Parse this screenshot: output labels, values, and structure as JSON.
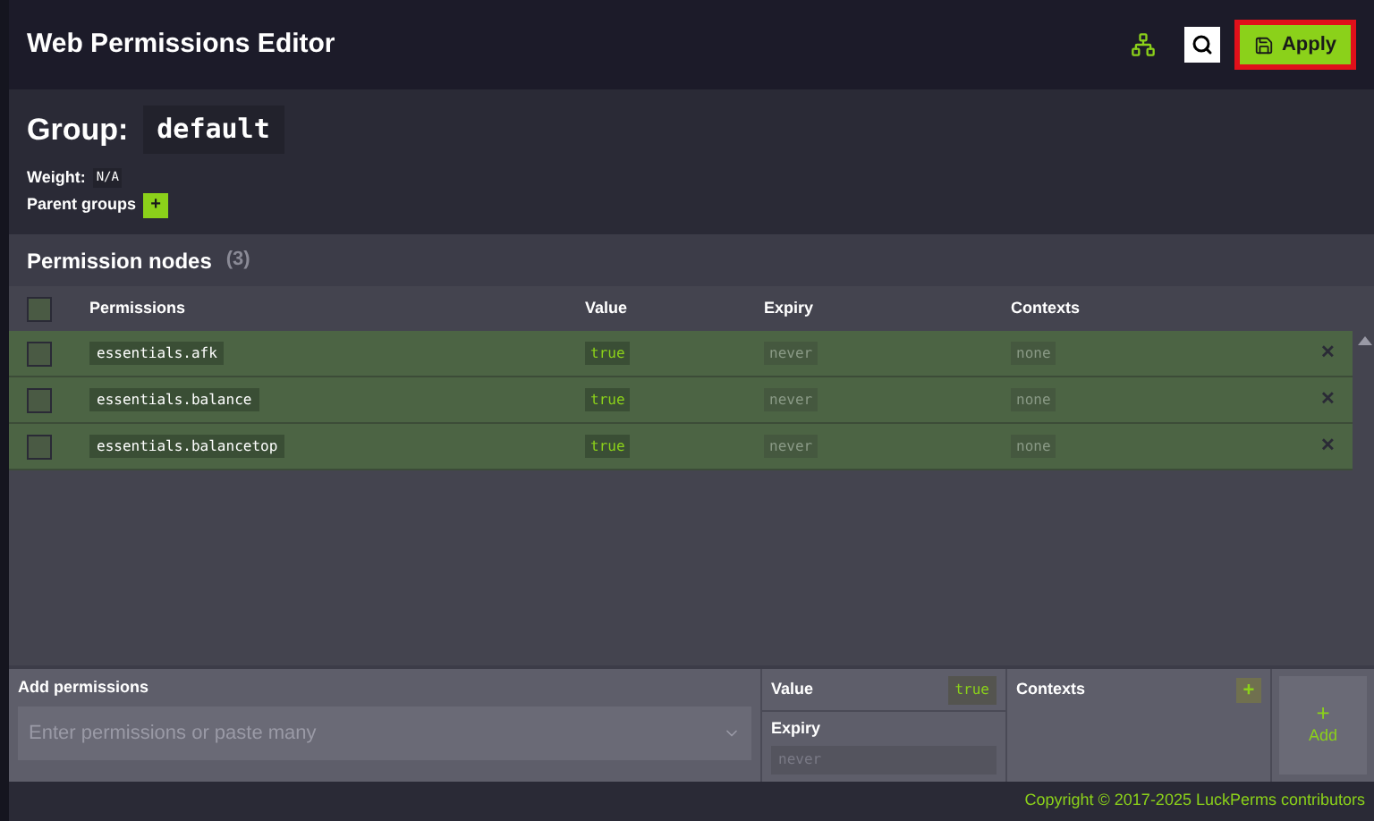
{
  "header": {
    "title": "Web Permissions Editor",
    "apply_label": "Apply"
  },
  "group": {
    "label": "Group:",
    "name": "default",
    "weight_label": "Weight:",
    "weight": "N/A",
    "parent_groups_label": "Parent groups",
    "add_parent": "+"
  },
  "nodes": {
    "title": "Permission nodes",
    "count": "(3)",
    "select_all_checked": false,
    "columns": [
      "Permissions",
      "Value",
      "Expiry",
      "Contexts"
    ],
    "rows": [
      {
        "permission": "essentials.afk",
        "value": "true",
        "expiry": "never",
        "contexts": "none",
        "checked": false,
        "remove": "✕"
      },
      {
        "permission": "essentials.balance",
        "value": "true",
        "expiry": "never",
        "contexts": "none",
        "checked": false,
        "remove": "✕"
      },
      {
        "permission": "essentials.balancetop",
        "value": "true",
        "expiry": "never",
        "contexts": "none",
        "checked": false,
        "remove": "✕"
      }
    ]
  },
  "add": {
    "label": "Add permissions",
    "placeholder": "Enter permissions or paste many",
    "value_label": "Value",
    "value": "true",
    "expiry_label": "Expiry",
    "expiry_placeholder": "never",
    "contexts_label": "Contexts",
    "contexts_add": "+",
    "add_icon": "+",
    "add_label": "Add"
  },
  "footer": "Copyright © 2017-2025 LuckPerms contributors"
}
